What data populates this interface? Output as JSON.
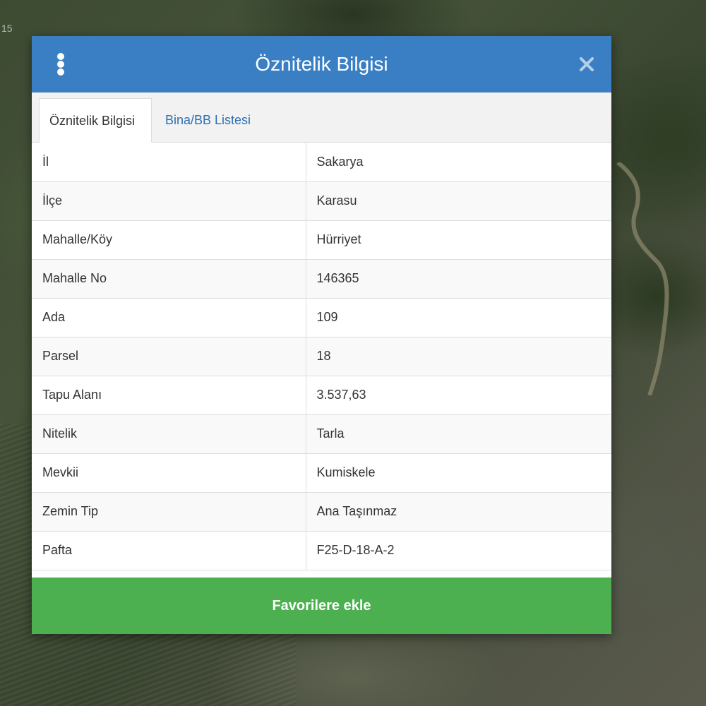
{
  "map": {
    "corner_label": "15"
  },
  "dialog": {
    "title": "Öznitelik Bilgisi",
    "menu_icon": "vertical-dots-icon",
    "close_icon": "close-icon"
  },
  "tabs": [
    {
      "label": "Öznitelik Bilgisi",
      "active": true
    },
    {
      "label": "Bina/BB Listesi",
      "active": false
    }
  ],
  "attributes": [
    {
      "key": "İl",
      "value": "Sakarya"
    },
    {
      "key": "İlçe",
      "value": "Karasu"
    },
    {
      "key": "Mahalle/Köy",
      "value": "Hürriyet"
    },
    {
      "key": "Mahalle No",
      "value": "146365"
    },
    {
      "key": "Ada",
      "value": "109"
    },
    {
      "key": "Parsel",
      "value": "18"
    },
    {
      "key": "Tapu Alanı",
      "value": "3.537,63"
    },
    {
      "key": "Nitelik",
      "value": "Tarla"
    },
    {
      "key": "Mevkii",
      "value": "Kumiskele"
    },
    {
      "key": "Zemin Tip",
      "value": "Ana Taşınmaz"
    },
    {
      "key": "Pafta",
      "value": "F25-D-18-A-2"
    }
  ],
  "actions": {
    "favorite_label": "Favorilere ekle"
  },
  "colors": {
    "header": "#3a7fc4",
    "button": "#4cb050",
    "tab_link": "#2e6fb3"
  }
}
